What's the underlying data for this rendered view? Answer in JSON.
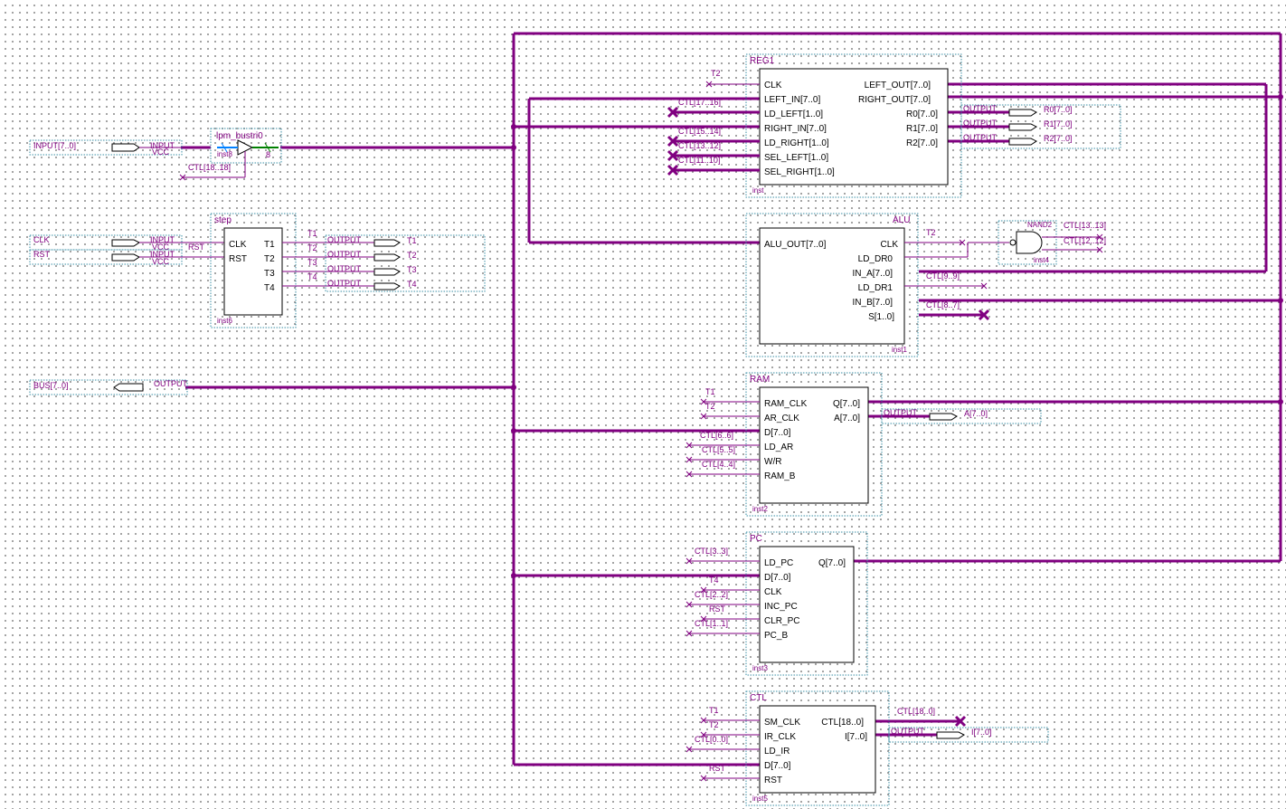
{
  "io_pins": {
    "input_data": {
      "name": "INPUT[7..0]",
      "type": "INPUT",
      "vcc": "VCC"
    },
    "clk": {
      "name": "CLK",
      "type": "INPUT",
      "vcc": "VCC"
    },
    "rst": {
      "name": "RST",
      "type": "INPUT",
      "vcc": "VCC"
    },
    "bus": {
      "name": "BUS[7..0]",
      "type": "OUTPUT"
    },
    "t_outputs": [
      {
        "type": "OUTPUT",
        "name": "T1"
      },
      {
        "type": "OUTPUT",
        "name": "T2"
      },
      {
        "type": "OUTPUT",
        "name": "T3"
      },
      {
        "type": "OUTPUT",
        "name": "T4"
      }
    ],
    "reg_outputs": [
      {
        "type": "OUTPUT",
        "name": "R0[7..0]"
      },
      {
        "type": "OUTPUT",
        "name": "R1[7..0]"
      },
      {
        "type": "OUTPUT",
        "name": "R2[7..0]"
      }
    ],
    "ram_output": {
      "type": "OUTPUT",
      "name": "A[7..0]"
    },
    "ctl_output": {
      "type": "OUTPUT",
      "name": "I[7..0]"
    }
  },
  "bustri": {
    "title": "lpm_bustri0",
    "inst": "inst8",
    "width": "8",
    "ctl": "CTL[18..18]"
  },
  "step": {
    "title": "step",
    "inst": "inst6",
    "inputs": [
      "CLK",
      "RST"
    ],
    "outputs": [
      "T1",
      "T2",
      "T3",
      "T4"
    ],
    "rst_net": "RST",
    "out_nets": [
      "T1",
      "T2",
      "T3",
      "T4"
    ]
  },
  "reg1": {
    "title": "REG1",
    "inst": "inst",
    "inputs": [
      "CLK",
      "LEFT_IN[7..0]",
      "LD_LEFT[1..0]",
      "RIGHT_IN[7..0]",
      "LD_RIGHT[1..0]",
      "SEL_LEFT[1..0]",
      "SEL_RIGHT[1..0]"
    ],
    "outputs": [
      "LEFT_OUT[7..0]",
      "RIGHT_OUT[7..0]",
      "R0[7..0]",
      "R1[7..0]",
      "R2[7..0]"
    ],
    "nets": {
      "clk": "T2",
      "ld_left": "CTL[17..16]",
      "ld_right": "CTL[15..14]",
      "sel_left": "CTL[13..12]",
      "sel_right": "CTL[11..10]"
    }
  },
  "alu": {
    "title": "ALU",
    "inst": "inst1",
    "input_left": "ALU_OUT[7..0]",
    "ports": [
      "CLK",
      "LD_DR0",
      "IN_A[7..0]",
      "LD_DR1",
      "IN_B[7..0]",
      "S[1..0]"
    ],
    "nets": {
      "clk": "T2",
      "ld_dr0": "CTL[9..9]",
      "s": "CTL[8..7]"
    }
  },
  "nand": {
    "title": "NAND2",
    "inst": "inst4",
    "in1": "CTL[13..13]",
    "in2": "CTL[12..12]"
  },
  "ram": {
    "title": "RAM",
    "inst": "inst2",
    "inputs": [
      "RAM_CLK",
      "AR_CLK",
      "D[7..0]",
      "LD_AR",
      "W/R",
      "RAM_B"
    ],
    "outputs": [
      "Q[7..0]",
      "A[7..0]"
    ],
    "nets": [
      "T1",
      "T2",
      "CTL[6..6]",
      "CTL[5..5]",
      "CTL[4..4]",
      ""
    ]
  },
  "pc": {
    "title": "PC",
    "inst": "inst3",
    "inputs": [
      "LD_PC",
      "D[7..0]",
      "CLK",
      "INC_PC",
      "CLR_PC",
      "PC_B"
    ],
    "outputs": [
      "Q[7..0]"
    ],
    "nets": [
      "CTL[3..3]",
      "",
      "T4",
      "CTL[2..2]",
      "RST",
      "CTL[1..1]"
    ]
  },
  "ctl": {
    "title": "CTL",
    "inst": "inst5",
    "inputs": [
      "SM_CLK",
      "IR_CLK",
      "LD_IR",
      "D[7..0]",
      "RST"
    ],
    "outputs": [
      "CTL[18..0]",
      "I[7..0]"
    ],
    "nets": [
      "T1",
      "T2",
      "CTL[0..0]",
      "",
      "RST"
    ],
    "out_net": "CTL[18..0]"
  },
  "colors": {
    "wire": "#800080",
    "block_border": "#000000",
    "group_border": "#3a8fa6",
    "port_bus": "#0080ff",
    "tri_out": "#008000"
  }
}
